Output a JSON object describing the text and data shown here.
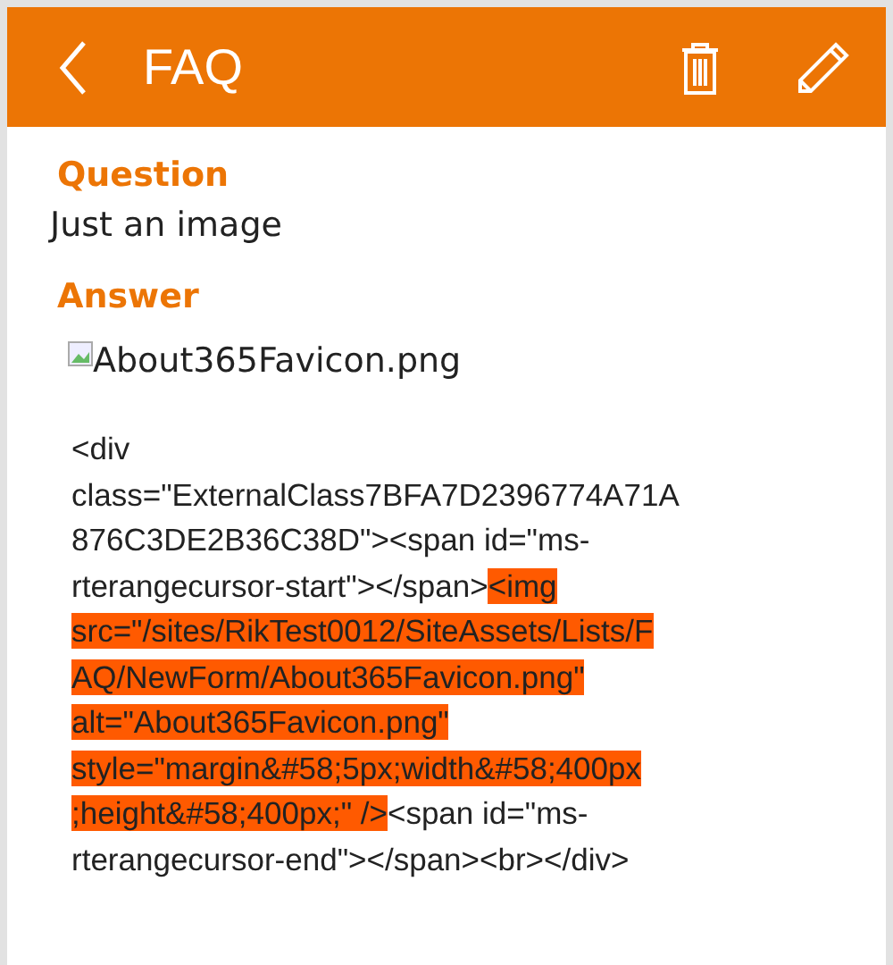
{
  "header": {
    "title": "FAQ"
  },
  "fields": [
    {
      "label": "Question",
      "value": "Just an image"
    },
    {
      "label": "Answer",
      "image_alt": "About365Favicon.png"
    }
  ],
  "code": [
    {
      "text": "<div\nclass=\"ExternalClass7BFA7D2396774A71A\n876C3DE2B36C38D\"><span id=\"ms-\nrterangecursor-start\"></span>",
      "highlighted": false
    },
    {
      "text": "<img\nsrc=\"/sites/RikTest0012/SiteAssets/Lists/F\nAQ/NewForm/About365Favicon.png\"\nalt=\"About365Favicon.png\"\nstyle=\"margin&#58;5px;width&#58;400px\n;height&#58;400px;\" />",
      "highlighted": true
    },
    {
      "text": "<span id=\"ms-\nrterangecursor-end\"></span><br></div>",
      "highlighted": false
    }
  ]
}
